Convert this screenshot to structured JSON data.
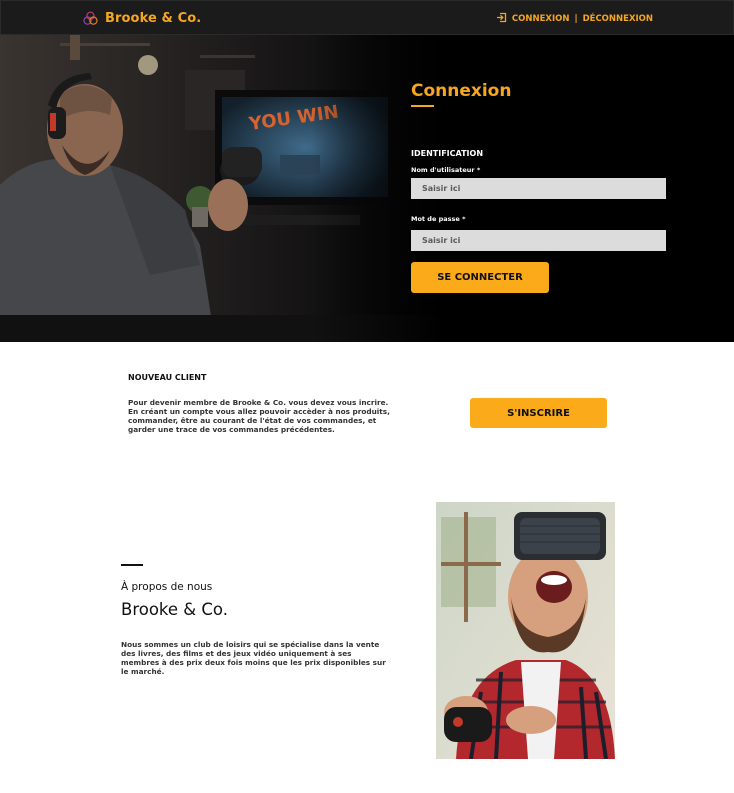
{
  "header": {
    "brand_name": "Brooke & Co.",
    "nav_login": "CONNEXION",
    "nav_separator": "|",
    "nav_logout": "DÉCONNEXION"
  },
  "login": {
    "title": "Connexion",
    "section_label": "IDENTIFICATION",
    "username_label": "Nom d'utilisateur *",
    "username_placeholder": "Saisir ici",
    "password_label": "Mot de passe *",
    "password_placeholder": "Saisir ici",
    "submit_label": "SE CONNECTER"
  },
  "new_client": {
    "title": "NOUVEAU CLIENT",
    "description": "Pour devenir membre de Brooke & Co.  vous devez vous incrire. En créant un compte vous allez pouvoir accèder à nos produits, commander, être au courant de l'état de vos commandes, et garder une trace de vos commandes précédentes.",
    "signup_label": "S'INSCRIRE"
  },
  "about": {
    "label": "À propos de nous",
    "name": "Brooke & Co.",
    "description": "Nous sommes un club de loisirs qui se spécialise dans la vente des livres, des films et des jeux vidéo uniquement à ses membres à des prix deux fois moins que les prix disponibles sur le marché."
  },
  "colors": {
    "accent": "#f5a623",
    "button": "#fbaa1a",
    "header_bg": "#1b1b1b",
    "hero_bg": "#000000",
    "input_bg": "#dcdcdc"
  },
  "icons": {
    "brand": "triple-circles-logo-icon",
    "login": "login-arrow-icon"
  }
}
